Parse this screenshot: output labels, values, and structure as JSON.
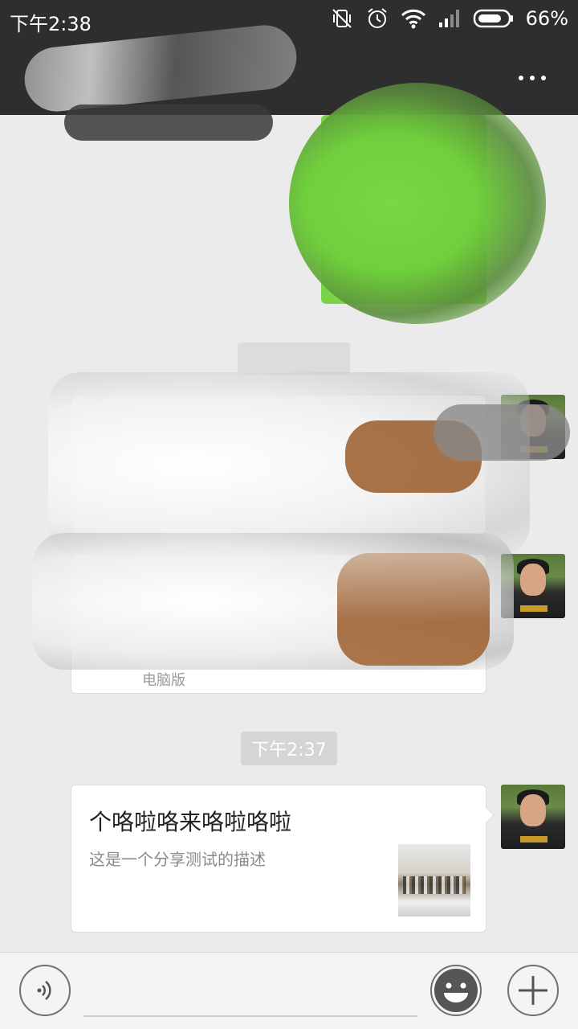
{
  "status_bar": {
    "time": "下午2:38",
    "battery_percent": "66%",
    "icons": [
      "mute-vibrate-icon",
      "alarm-icon",
      "wifi-icon",
      "signal-icon",
      "battery-icon"
    ]
  },
  "header": {
    "more_icon": "more-dots-icon"
  },
  "chat": {
    "timestamp": "下午2:37",
    "card_footer_partial": "电脑版",
    "share_card": {
      "title": "个咯啦咯来咯啦咯啦",
      "description": "这是一个分享测试的描述",
      "thumbnail": "group-photo-thumbnail"
    }
  },
  "input_bar": {
    "voice_icon": "voice-icon",
    "emoji_icon": "emoji-icon",
    "plus_icon": "plus-icon"
  },
  "colors": {
    "topbar": "#2e2e2e",
    "chat_background": "#ebebeb",
    "sent_bubble": "#7bd348"
  }
}
